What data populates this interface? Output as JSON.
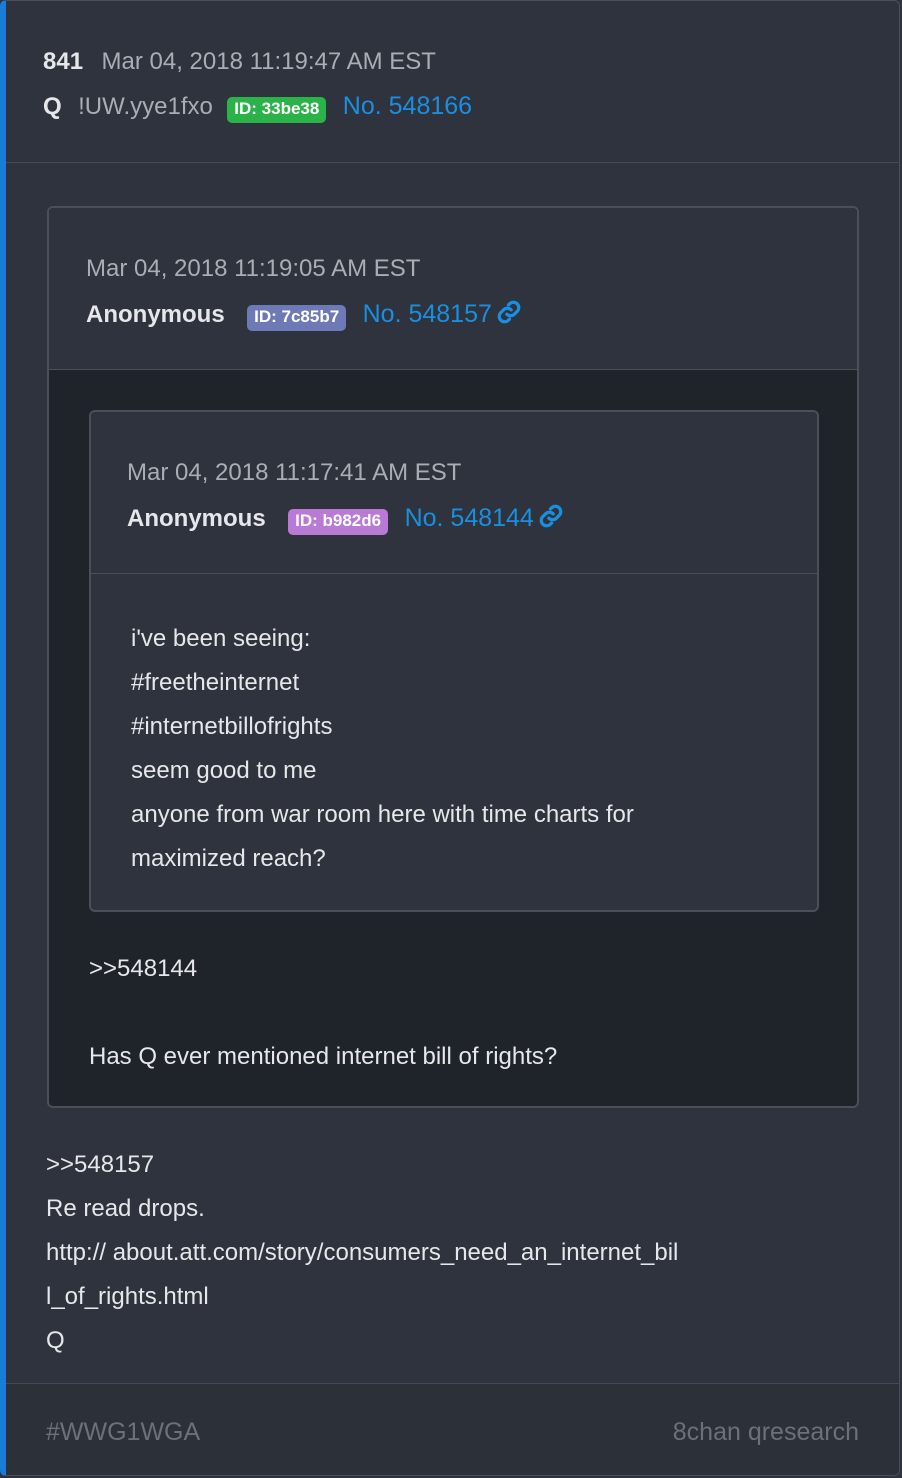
{
  "post": {
    "number": "841",
    "date": "Mar 04, 2018 11:19:47 AM EST",
    "author": "Q",
    "tripcode": "!UW.yye1fxo",
    "id_badge": "ID: 33be38",
    "id_color": "#2bb34a",
    "post_no": "No. 548166",
    "body_lines": [
      ">>548157",
      "Re read drops.",
      "http:// about.att.com/story/consumers_need_an_internet_bil",
      "l_of_rights.html",
      "Q"
    ]
  },
  "quote1": {
    "date": "Mar 04, 2018 11:19:05 AM EST",
    "author": "Anonymous",
    "id_badge": "ID: 7c85b7",
    "id_color": "#6e7ab5",
    "post_no": "No. 548157",
    "link_icon": "link-icon",
    "body_lines": [
      ">>548144",
      "",
      "Has Q ever mentioned internet bill of rights?"
    ]
  },
  "quote2": {
    "date": "Mar 04, 2018 11:17:41 AM EST",
    "author": "Anonymous",
    "id_badge": "ID: b982d6",
    "id_color": "#b97ad6",
    "post_no": "No. 548144",
    "link_icon": "link-icon",
    "body_lines": [
      "i've been seeing:",
      "#freetheinternet",
      "#internetbillofrights",
      "seem good to me",
      "anyone from war room here with time charts for",
      "maximized reach?"
    ]
  },
  "footer": {
    "hashtag": "#WWG1WGA",
    "source": "8chan qresearch"
  }
}
